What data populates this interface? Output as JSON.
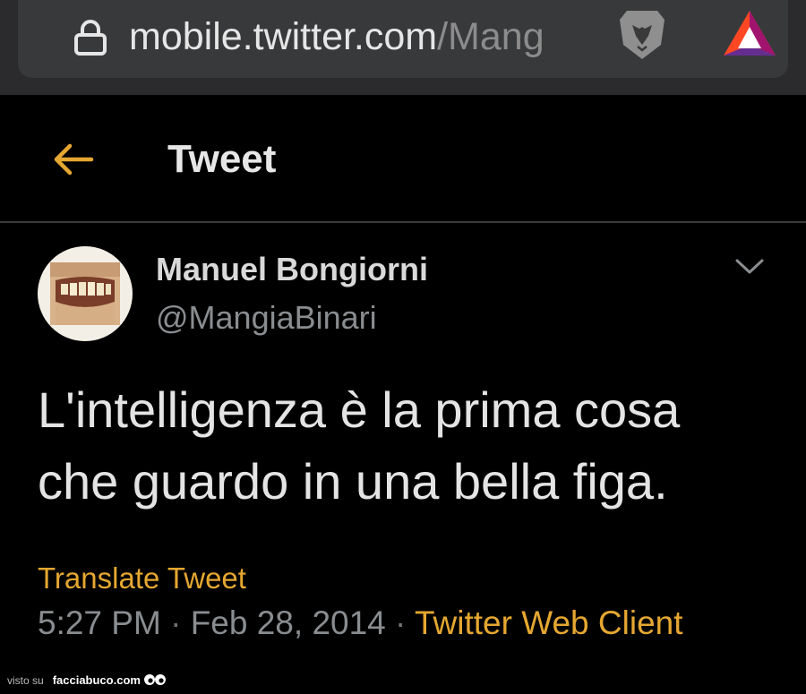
{
  "browser": {
    "url_domain": "mobile.twitter.com",
    "url_path": "/Mang",
    "icons": [
      "lock-icon",
      "brave-lion-icon",
      "bat-triangle-icon"
    ]
  },
  "header": {
    "title": "Tweet",
    "back_icon": "back-arrow-icon",
    "accent_color": "#e5a731"
  },
  "tweet": {
    "display_name": "Manuel Bongiorni",
    "username": "@MangiaBinari",
    "text_line1": "L'intelligenza è la prima cosa",
    "text_line2": "che guardo in una bella figa.",
    "translate_label": "Translate Tweet",
    "time": "5:27 PM",
    "separator": "·",
    "date": "Feb 28, 2014",
    "client": "Twitter Web Client",
    "menu_icon": "chevron-down-icon"
  },
  "watermark": {
    "prefix": "visto su",
    "brand": "facciabuco.com"
  }
}
